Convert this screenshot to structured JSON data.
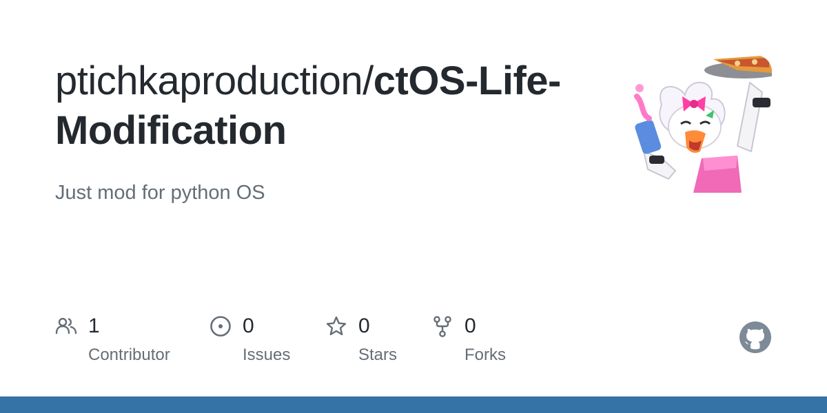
{
  "repo": {
    "owner": "ptichkaproduction/",
    "name": "ctOS-Life-Modification",
    "description": "Just mod for python OS"
  },
  "stats": [
    {
      "icon": "people-icon",
      "value": "1",
      "label": "Contributor"
    },
    {
      "icon": "issue-opened-icon",
      "value": "0",
      "label": "Issues"
    },
    {
      "icon": "star-icon",
      "value": "0",
      "label": "Stars"
    },
    {
      "icon": "repo-forked-icon",
      "value": "0",
      "label": "Forks"
    }
  ],
  "colors": {
    "title": "#24292f",
    "muted": "#656d76",
    "bar": "#3572a5",
    "mark": "#7d8a97"
  }
}
